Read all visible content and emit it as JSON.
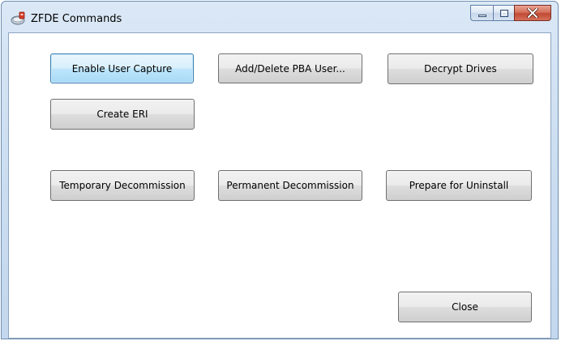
{
  "window": {
    "title": "ZFDE Commands",
    "icon": "zfde-app-icon"
  },
  "caption_buttons": {
    "minimize_icon": "minimize-icon",
    "maximize_icon": "maximize-icon",
    "close_icon": "close-icon"
  },
  "buttons": {
    "enable_user_capture": "Enable User Capture",
    "add_delete_pba_user": "Add/Delete PBA User...",
    "decrypt_drives": "Decrypt Drives",
    "create_eri": "Create ERI",
    "temporary_decommission": "Temporary Decommission",
    "permanent_decommission": "Permanent Decommission",
    "prepare_for_uninstall": "Prepare for Uninstall",
    "close": "Close"
  },
  "colors": {
    "focus_border": "#3c7fb1",
    "close_red": "#c14a34"
  }
}
